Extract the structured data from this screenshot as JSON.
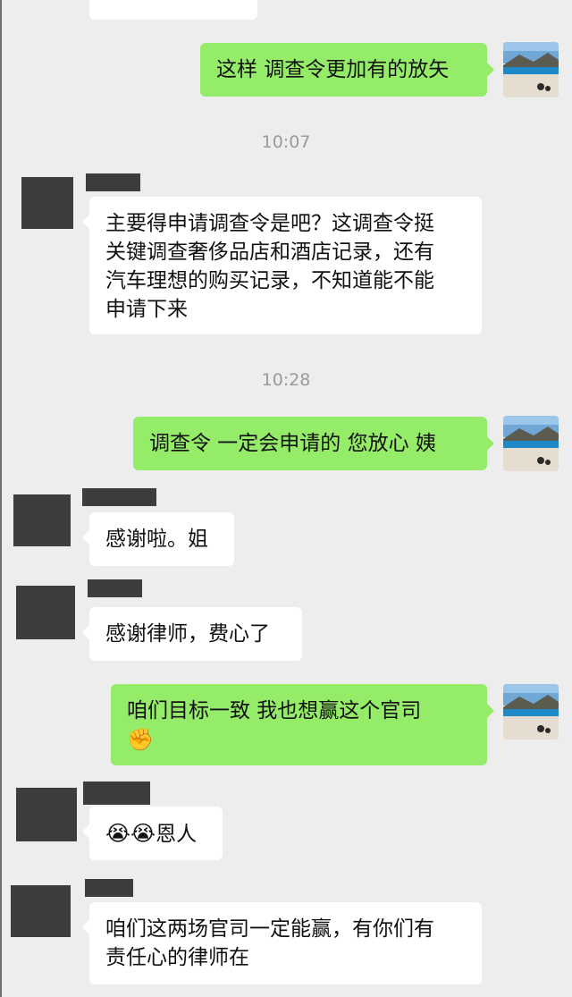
{
  "messages": [
    {
      "side": "out",
      "text": "这样 调查令更加有的放矢"
    },
    {
      "type": "time",
      "text": "10:07"
    },
    {
      "side": "in",
      "lines": [
        "主要得申请调查令是吧？这调查令挺",
        "关键调查奢侈品店和酒店记录，还有",
        "汽车理想的购买记录，不知道能不能",
        "申请下来"
      ]
    },
    {
      "type": "time",
      "text": "10:28"
    },
    {
      "side": "out",
      "text": "调查令 一定会申请的  您放心 姨"
    },
    {
      "side": "in",
      "text": "感谢啦。姐"
    },
    {
      "side": "in",
      "text": "感谢律师，费心了"
    },
    {
      "side": "out",
      "text": "咱们目标一致   我也想赢这个官司",
      "emoji": "✊"
    },
    {
      "side": "in",
      "emoji": "😭😭",
      "text": "恩人"
    },
    {
      "side": "in",
      "lines": [
        "咱们这两场官司一定能赢，有你们有",
        "责任心的律师在"
      ]
    }
  ],
  "colors": {
    "background": "#ededed",
    "out_bubble": "#95ec69",
    "in_bubble": "#ffffff",
    "time": "#9a9a9a"
  }
}
